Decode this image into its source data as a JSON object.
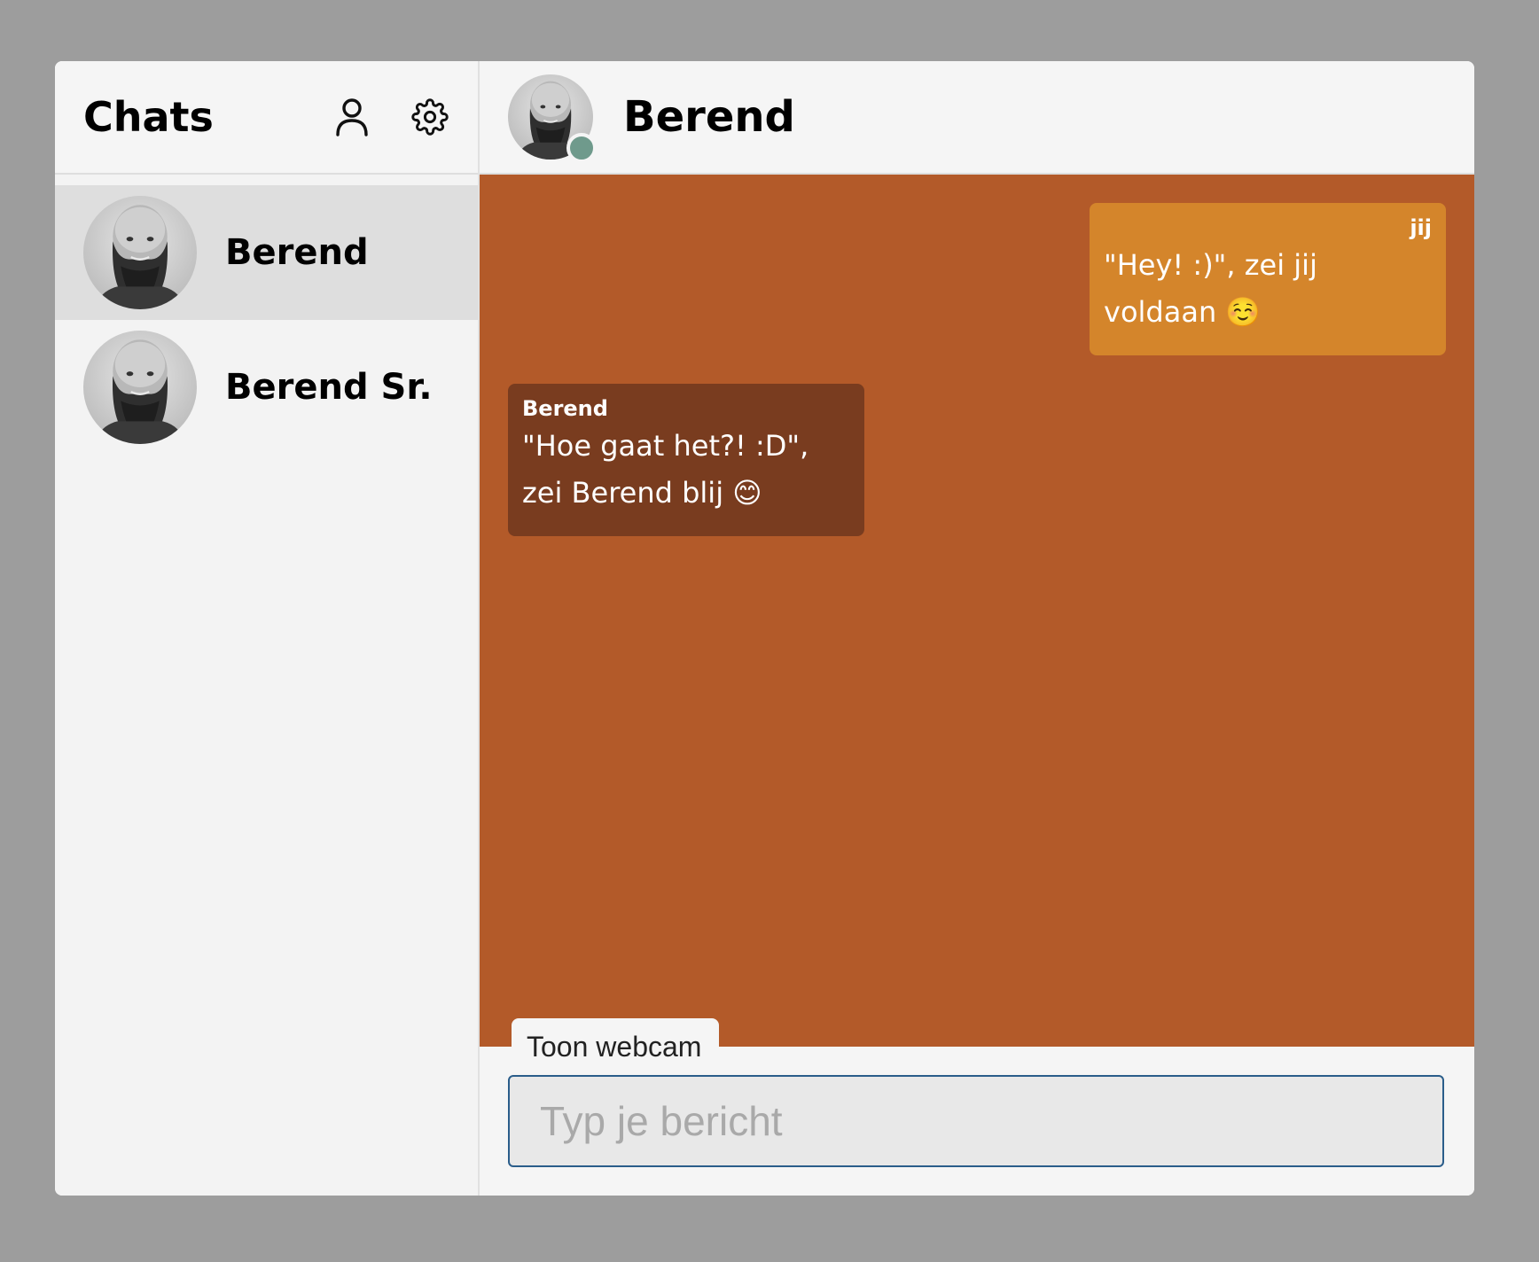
{
  "sidebar": {
    "title": "Chats",
    "icons": {
      "profile": "person-icon",
      "settings": "gear-icon"
    },
    "chats": [
      {
        "name": "Berend",
        "active": true
      },
      {
        "name": "Berend Sr.",
        "active": false
      }
    ]
  },
  "conversation": {
    "contact_name": "Berend",
    "status_color": "#6f9a8c",
    "messages": [
      {
        "sender": "jij",
        "text": "\"Hey! :)\", zei jij voldaan ☺️",
        "direction": "out"
      },
      {
        "sender": "Berend",
        "text": "\"Hoe gaat het?! :D\", zei Berend blij 😊",
        "direction": "in"
      }
    ]
  },
  "composer": {
    "webcam_label": "Toon webcam",
    "placeholder": "Typ je bericht",
    "value": ""
  },
  "colors": {
    "chat_background": "#b35a29",
    "outgoing_bubble": "#d4852b",
    "incoming_bubble": "#793c1f",
    "input_border": "#2a5d8a"
  }
}
